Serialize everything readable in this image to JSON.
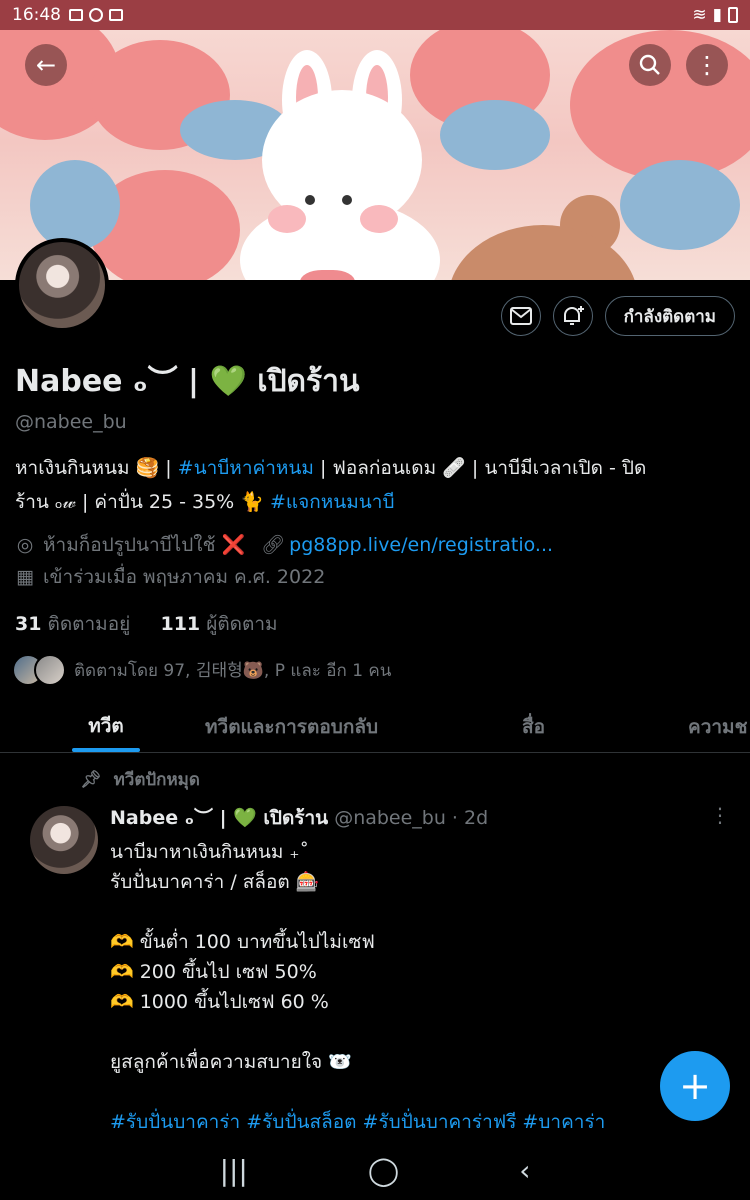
{
  "statusbar": {
    "time": "16:48"
  },
  "banner": {
    "back_icon": "arrow-left-icon",
    "search_icon": "search-icon",
    "more_icon": "more-vertical-icon"
  },
  "actions": {
    "mail_icon": "mail-icon",
    "bell_icon": "bell-plus-icon",
    "following_label": "กำลังติดตาม"
  },
  "profile": {
    "name": "Nabee ₒ︶ | 💚 เปิดร้าน",
    "handle": "@nabee_bu",
    "bio_line1_a": "หาเงินกินหนม 🥞 | ",
    "bio_tag1": "#นาบีหาค่าหนม",
    "bio_line1_b": " | ฟอลก่อนเดม 🩹 | นาบีมีเวลาเปิด - ปิด",
    "bio_line2_a": "ร้าน ₒ𝓌 | ค่าปั่น 25 - 35% 🐈 ",
    "bio_tag2": "#แจกหนมนาบี",
    "location": "ห้ามก็อปรูปนาบีไปใช้ ❌",
    "website": "pg88pp.live/en/registratio...",
    "joined": "เข้าร่วมเมื่อ พฤษภาคม ค.ศ. 2022",
    "following_count": "31",
    "following_label": "ติดตามอยู่",
    "followers_count": "111",
    "followers_label": "ผู้ติดตาม",
    "followed_by": "ติดตามโดย 97, 김태형🐻, P และ อีก 1 คน"
  },
  "tabs": [
    {
      "label": "ทวีต"
    },
    {
      "label": "ทวีตและการตอบกลับ"
    },
    {
      "label": "สื่อ"
    },
    {
      "label": "ความช"
    }
  ],
  "pinned_label": "ทวีตปักหมุด",
  "tweet": {
    "name": "Nabee ₒ︶ | 💚 เปิดร้าน",
    "handle": "@nabee_bu",
    "time": "· 2d",
    "lines": [
      "นาบีมาหาเงินกินหนม ₊˚",
      "รับปั่นบาคาร่า / สล็อต 🎰",
      "",
      "🫶 ขั้นต่ำ 100 บาทขึ้นไปไม่เซฟ",
      "🫶 200 ขึ้นไป เซฟ 50%",
      "🫶 1000 ขึ้นไปเซฟ 60 %",
      "",
      "ยูสลูกค้าเพื่อความสบายใจ 🐻‍❄️",
      ""
    ],
    "hashtags": "#รับปั่นบาคาร่า #รับปั่นสล็อต #รับปั่นบาคาร่าฟรี #บาคาร่า"
  },
  "fab": {
    "label": "+"
  },
  "navbar": {
    "recents": "|||",
    "home": "◯",
    "back": "‹"
  }
}
